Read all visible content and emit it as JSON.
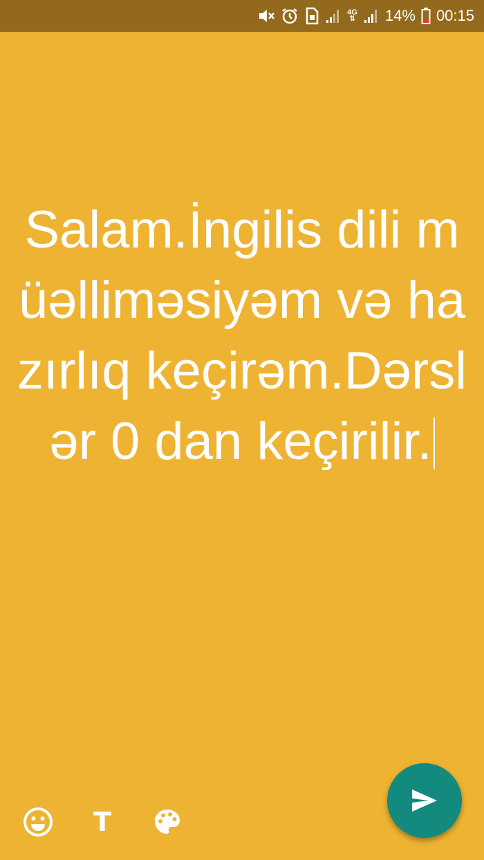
{
  "status_bar": {
    "battery": "14%",
    "time": "00:15",
    "network_type": "4G",
    "icons": [
      "mute-icon",
      "alarm-icon",
      "sim-icon",
      "signal-icon",
      "network-4g-icon",
      "signal-icon",
      "battery-icon"
    ]
  },
  "editor": {
    "text": "Salam.İngilis dili müəllimə­siyəm və hazırlıq keçirəm.Dərslə­r 0 dan keçirilir."
  },
  "toolbar": {
    "emoji_icon": "emoji-icon",
    "text_label": "T",
    "palette_icon": "palette-icon",
    "send_icon": "send-icon"
  },
  "colors": {
    "background": "#eeb332",
    "status_bar": "#936a1d",
    "send_button": "#128a7d",
    "text": "#ffffff"
  }
}
